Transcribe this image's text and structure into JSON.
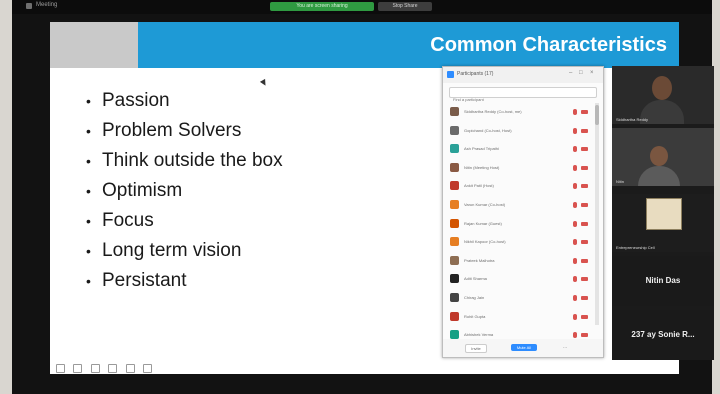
{
  "window": {
    "title": "Meeting",
    "share_banner": "You are screen sharing",
    "stop_share": "Stop Share"
  },
  "slide": {
    "title": "Common Characteristics",
    "bullets": [
      "Passion",
      "Problem Solvers",
      "Think outside the box",
      "Optimism",
      "Focus",
      "Long term vision",
      "Persistant"
    ]
  },
  "participants": {
    "title": "Participants (17)",
    "search_placeholder": "Find a participant",
    "rows": [
      {
        "name": "Siddhartha Reddy (Co-host, me)",
        "avatar_color": "#7a5c4a"
      },
      {
        "name": "Gopichand (Co-host, Host)",
        "avatar_color": "#6b6b6b"
      },
      {
        "name": "Ash Prasad Tripathi",
        "avatar_color": "#2aa198"
      },
      {
        "name": "Nitin (Meeting Host)",
        "avatar_color": "#8a5a44"
      },
      {
        "name": "Ankit Patil (Host)",
        "avatar_color": "#c0392b"
      },
      {
        "name": "Varun Kumar (Co-host)",
        "avatar_color": "#e67e22"
      },
      {
        "name": "Rajan Kumar (Guest)",
        "avatar_color": "#d35400"
      },
      {
        "name": "Nikhil Kapoor (Co-host)",
        "avatar_color": "#e67e22"
      },
      {
        "name": "Prateek Malhotra",
        "avatar_color": "#8e6e53"
      },
      {
        "name": "Aditi Sharma",
        "avatar_color": "#222222"
      },
      {
        "name": "Chirag Jain",
        "avatar_color": "#444444"
      },
      {
        "name": "Rohit Gupta",
        "avatar_color": "#c0392b"
      },
      {
        "name": "Abhishek Verma",
        "avatar_color": "#16a085"
      }
    ],
    "invite_label": "Invite",
    "mute_all_label": "Mute All",
    "more_label": "..."
  },
  "gallery": {
    "tile1_label": "Siddhartha Reddy",
    "tile2_label": "Nitin",
    "logo_label": "Entrepreneurship Cell",
    "name_tile_1": "Nitin Das",
    "name_tile_2": "237 ay Sonie R..."
  },
  "colors": {
    "slide_header_blue": "#1e9ad6",
    "zoom_blue": "#2d8cff",
    "share_green": "#2f9a41",
    "muted_red": "#d9534f"
  }
}
